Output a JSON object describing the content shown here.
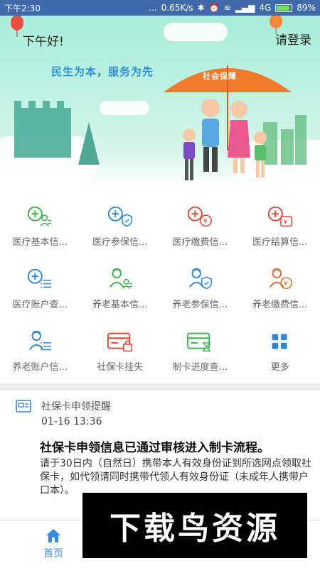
{
  "status_bar": {
    "time": "下午2:30",
    "dots": "...",
    "speed": "0.65K/s",
    "network": "4G",
    "battery": "89%",
    "battery_level": 0.89
  },
  "hero": {
    "greeting": "下午好!",
    "login": "请登录",
    "slogan": "民生为本，服务为先",
    "umbrella_text": "社会保障"
  },
  "grid": {
    "items": [
      {
        "label": "医疗基本信...",
        "icon": "medical-info-icon",
        "color": "#3bb44a"
      },
      {
        "label": "医疗参保信...",
        "icon": "medical-insured-icon",
        "color": "#2e86d6"
      },
      {
        "label": "医疗缴费信...",
        "icon": "medical-payment-icon",
        "color": "#e0452e"
      },
      {
        "label": "医疗结算信...",
        "icon": "medical-settlement-icon",
        "color": "#e0452e"
      },
      {
        "label": "医疗账户查...",
        "icon": "medical-account-icon",
        "color": "#2e86d6"
      },
      {
        "label": "养老基本信...",
        "icon": "pension-info-icon",
        "color": "#3bb44a"
      },
      {
        "label": "养老参保信...",
        "icon": "pension-insured-icon",
        "color": "#2e86d6"
      },
      {
        "label": "养老缴费信...",
        "icon": "pension-payment-icon",
        "color": "#e06a2e"
      },
      {
        "label": "养老账户信...",
        "icon": "pension-account-icon",
        "color": "#2e86d6"
      },
      {
        "label": "社保卡挂失",
        "icon": "card-lock-icon",
        "color": "#e0452e"
      },
      {
        "label": "制卡进度查...",
        "icon": "card-progress-icon",
        "color": "#3bb44a"
      },
      {
        "label": "更多",
        "icon": "more-grid-icon",
        "color": "#2e86d6"
      }
    ]
  },
  "notice": {
    "title": "社保卡申领提醒",
    "time": "01-16 13:36",
    "headline": "社保卡申领信息已通过审核进入制卡流程。",
    "body": "请于30日内（自然日）携带本人有效身份证到所选网点领取社保卡，如代领请同时携带代领人有效身份证（未成年人携带户口本）。"
  },
  "bottom_nav": {
    "home_label": "首页"
  },
  "watermark": {
    "text": "下载鸟资源"
  }
}
